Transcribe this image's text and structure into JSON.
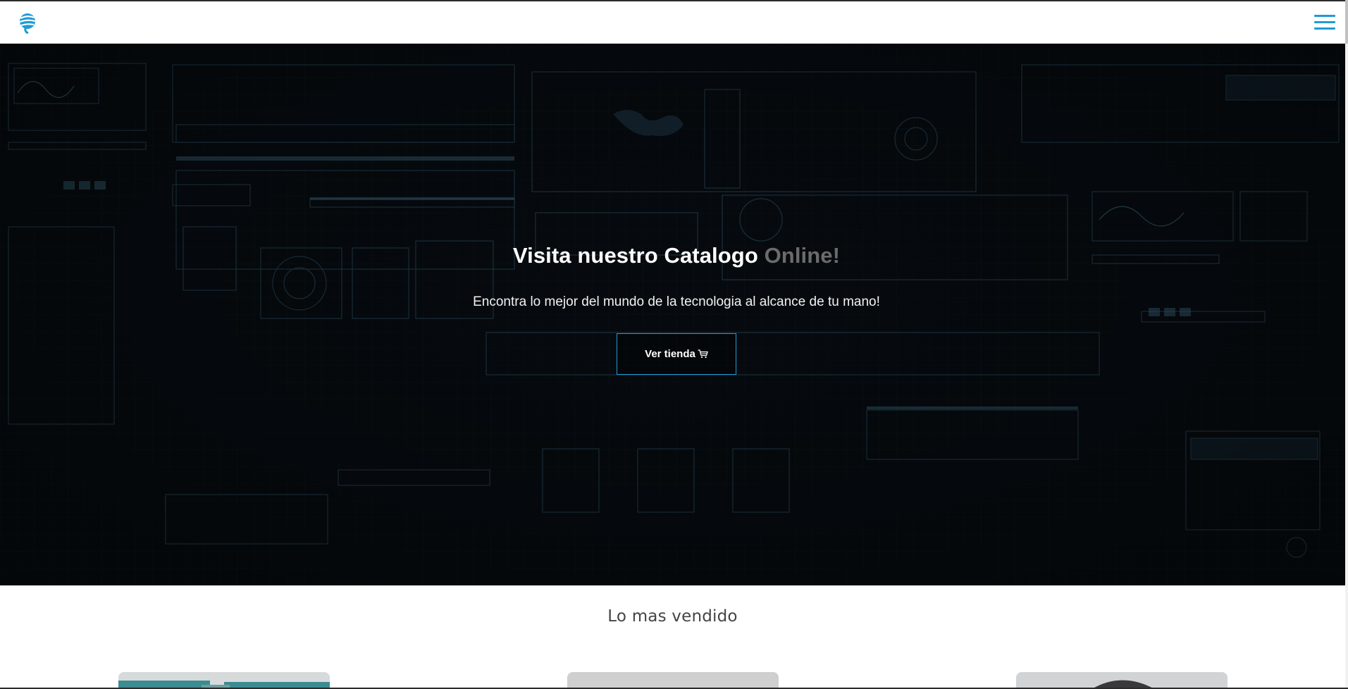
{
  "navbar": {
    "logo_icon": "globe-logo-icon",
    "menu_icon": "hamburger-menu-icon",
    "accent_color": "#1e9bd7"
  },
  "hero": {
    "title_main": "Visita nuestro Catalogo ",
    "title_accent": "Online!",
    "subtitle": "Encontra lo mejor del mundo de la tecnologia al alcance de tu mano!",
    "button_label": "Ver tienda",
    "button_icon": "shopping-cart-icon",
    "background": "dark-tech-hud-image"
  },
  "best_sellers": {
    "title": "Lo mas vendido",
    "cards": [
      {
        "image": "product-teal-image"
      },
      {
        "image": "product-gray-image"
      },
      {
        "image": "product-band-image"
      }
    ]
  }
}
